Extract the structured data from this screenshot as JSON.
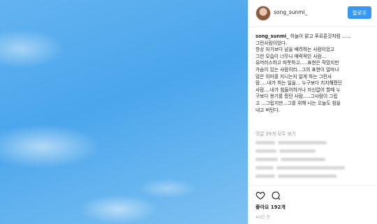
{
  "post": {
    "username": "song_sunmi_",
    "follow_label": "팔로우",
    "caption": {
      "user": "song_sunmi_",
      "lines": [
        " 하늘이 맑고 푸르른것처럼 ......",
        "그런사람이었다.",
        "항상 자기보다 남을 배려하는 사람이었고",
        "그런 모습이 너무나 매력적인 사람...",
        "유머러스하고 따뜻하고.....표현은 작았지만",
        "가슴이 있는 사람이라...그의 표현이 얼마나",
        "많은 의미를 지니는지 알게 하는 그런사",
        "람.....내가 하는 일을... 누구보다 지지해줬던",
        "사람....내가 힘들어하거나 자신없어 할때 누",
        "구보다 용기를 줬던 사람.....그사람이 그립",
        "고 ...그립지만...그를 위해 나는 오늘도 힘을",
        "내고 버틴다."
      ]
    },
    "more_comments": "댓글 39개 모두 보기",
    "comments": [
      "",
      "",
      "",
      "",
      ""
    ],
    "likes": "좋아요 192개",
    "time": "4시간 전"
  }
}
